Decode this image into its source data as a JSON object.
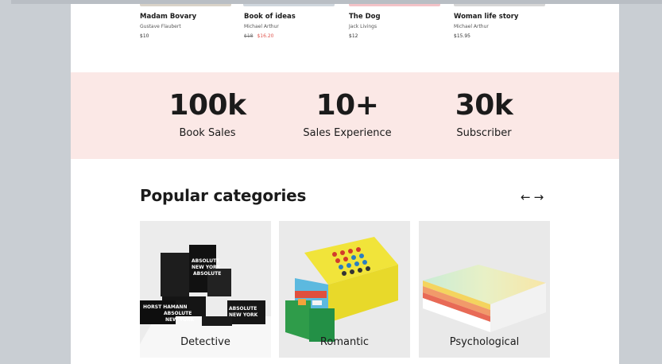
{
  "books": [
    {
      "title": "Madam Bovary",
      "author": "Gustave Flaubert",
      "price": "$10",
      "old_price": ""
    },
    {
      "title": "Book of ideas",
      "author": "Michael Arthur",
      "price": "$16.20",
      "old_price": "$18"
    },
    {
      "title": "The Dog",
      "author": "Jack Livings",
      "price": "$12",
      "old_price": ""
    },
    {
      "title": "Woman life story",
      "author": "Michael Arthur",
      "price": "$15.95",
      "old_price": ""
    }
  ],
  "stats": [
    {
      "value": "100k",
      "label": "Book Sales"
    },
    {
      "value": "10+",
      "label": "Sales Experience"
    },
    {
      "value": "30k",
      "label": "Subscriber"
    }
  ],
  "categories_section": {
    "title": "Popular categories",
    "prev_icon": "arrow-left-icon",
    "next_icon": "arrow-right-icon",
    "prev_glyph": "←",
    "next_glyph": "→"
  },
  "categories": [
    {
      "label": "Detective"
    },
    {
      "label": "Romantic"
    },
    {
      "label": "Psychological"
    }
  ],
  "colors": {
    "stats_bg": "#fbe8e6",
    "sale_price": "#e0564f",
    "text_dark": "#1b1b1b"
  }
}
